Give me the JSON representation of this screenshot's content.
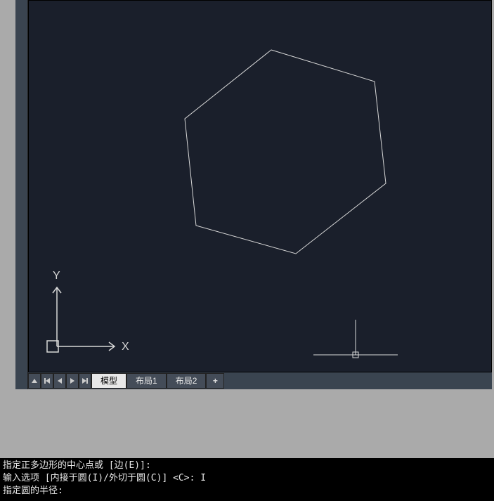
{
  "tabs": {
    "model": "模型",
    "layout1": "布局1",
    "layout2": "布局2",
    "add": "+"
  },
  "ucs": {
    "x_label": "X",
    "y_label": "Y"
  },
  "commandline": {
    "line1": "指定正多边形的中心点或 [边(E)]:",
    "line2": "输入选项 [内接于圆(I)/外切于圆(C)] <C>: I",
    "line3": "指定圆的半径:"
  }
}
